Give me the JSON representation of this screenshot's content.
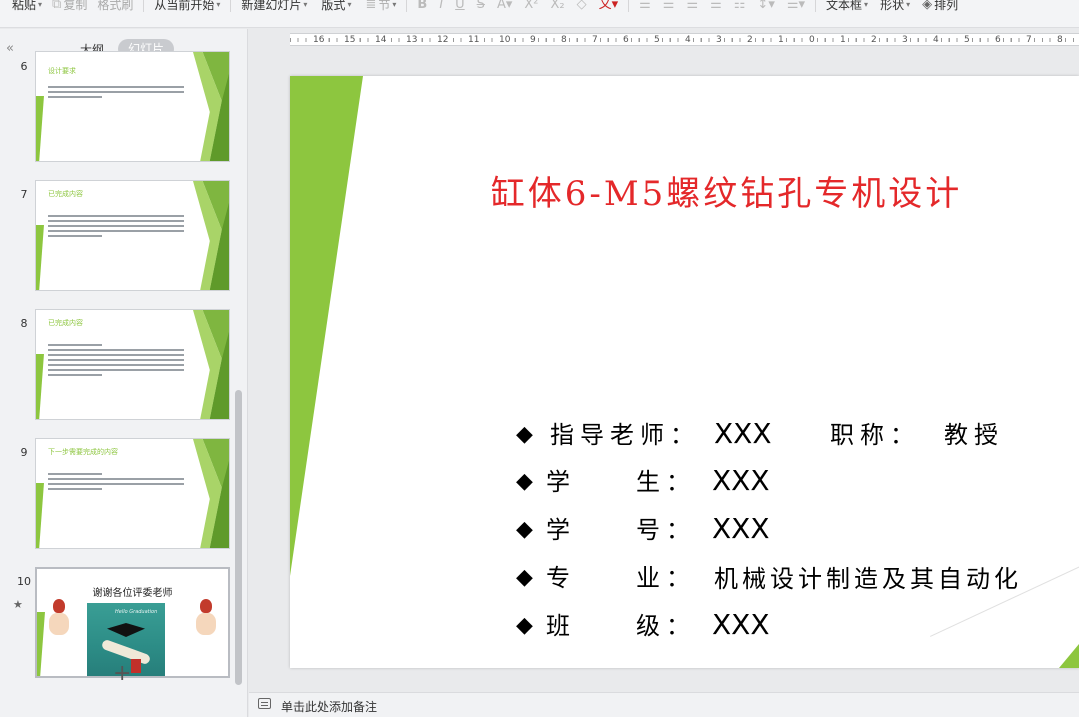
{
  "toolbar": {
    "paste": "粘贴",
    "copy": "复制",
    "format_painter": "格式刷",
    "play_from_current": "从当前开始",
    "new_slide": "新建幻灯片",
    "layout": "版式",
    "section": "节",
    "text_box": "文本框",
    "shape": "形状",
    "arrange": "排列"
  },
  "panel": {
    "tab_outline": "大纲",
    "tab_slides": "幻灯片"
  },
  "thumbnails": [
    {
      "num": "6",
      "title": "设计要求"
    },
    {
      "num": "7",
      "title": "已完成内容"
    },
    {
      "num": "8",
      "title": "已完成内容"
    },
    {
      "num": "9",
      "title": "下一步需要完成的内容"
    },
    {
      "num": "10",
      "title": "谢谢各位评委老师",
      "image_text": "Hello Graduation"
    }
  ],
  "ruler": {
    "labels": [
      "16",
      "15",
      "14",
      "13",
      "12",
      "11",
      "10",
      "9",
      "8",
      "7",
      "6",
      "5",
      "4",
      "3",
      "2",
      "1",
      "0",
      "1",
      "2",
      "3",
      "4",
      "5",
      "6",
      "7",
      "8"
    ]
  },
  "slide": {
    "title": "缸体6-M5螺纹钻孔专机设计",
    "rows": [
      {
        "bullet": "◆",
        "label": "指导老师：",
        "value": "XXX",
        "extra_label": "职称：",
        "extra_value": "教授"
      },
      {
        "bullet": "◆",
        "label": "学　　生：",
        "value": "XXX"
      },
      {
        "bullet": "◆",
        "label": "学　　号：",
        "value": "XXX"
      },
      {
        "bullet": "◆",
        "label": "专　　业：",
        "value": "机械设计制造及其自动化"
      },
      {
        "bullet": "◆",
        "label": "班　　级：",
        "value": "XXX"
      }
    ],
    "accent_color": "#8dc63f",
    "title_color": "#e4282a"
  },
  "notes": {
    "placeholder": "单击此处添加备注"
  }
}
